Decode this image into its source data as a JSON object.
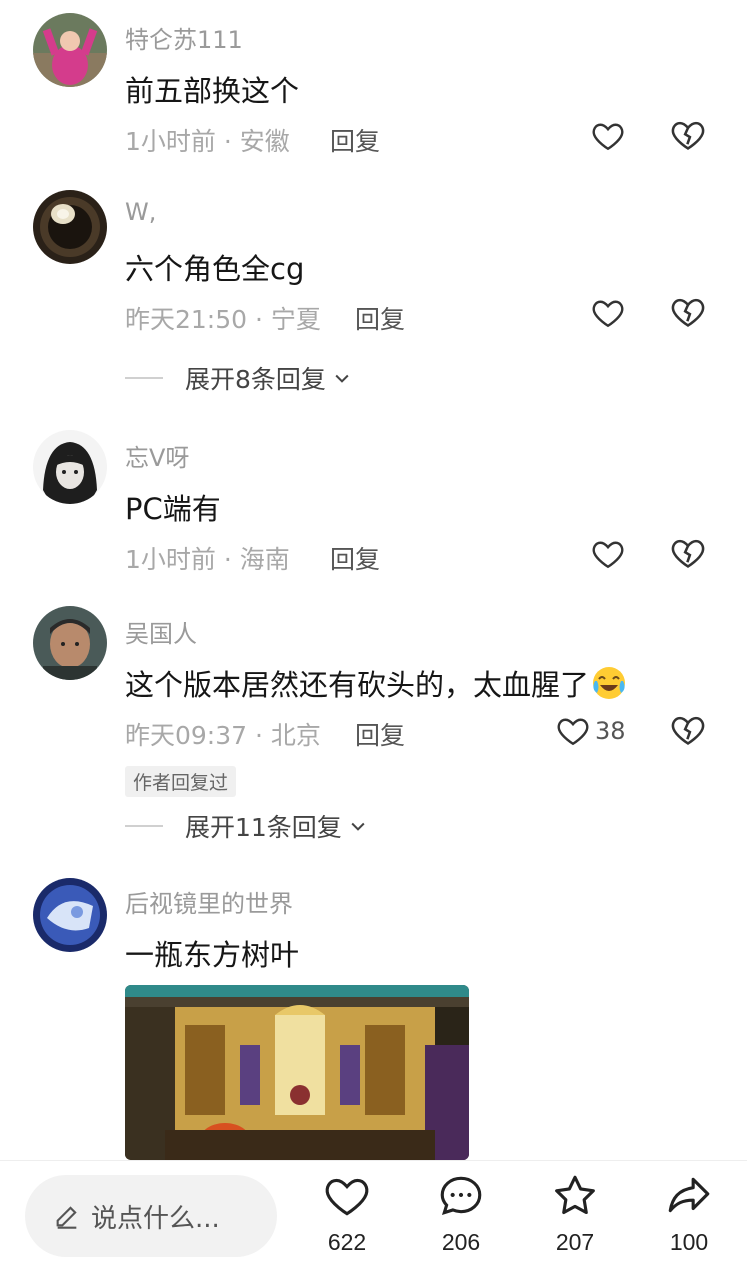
{
  "comments": [
    {
      "username": "特仑苏111",
      "content": "前五部换这个",
      "meta": "1小时前 · 安徽",
      "reply_label": "回复",
      "like_count": ""
    },
    {
      "username": "W,",
      "content": "六个角色全cg",
      "meta": "昨天21:50 · 宁夏",
      "reply_label": "回复",
      "like_count": "",
      "expand_label": "展开8条回复"
    },
    {
      "username": "忘V呀",
      "content": "PC端有",
      "meta": "1小时前 · 海南",
      "reply_label": "回复",
      "like_count": ""
    },
    {
      "username": "吴国人",
      "content": "这个版本居然还有砍头的，太血腥了",
      "meta": "昨天09:37 · 北京",
      "reply_label": "回复",
      "like_count": "38",
      "author_badge": "作者回复过",
      "expand_label": "展开11条回复"
    },
    {
      "username": "后视镜里的世界",
      "content": "一瓶东方树叶",
      "image_icon": "game-screenshot-image"
    }
  ],
  "bottom_bar": {
    "input_placeholder": "说点什么...",
    "like_count": "622",
    "comment_count": "206",
    "favorite_count": "207",
    "share_count": "100"
  },
  "icons": {
    "like": "heart-outline-icon",
    "dislike": "broken-heart-icon",
    "expand": "chevron-down-icon",
    "edit": "pencil-icon",
    "comment": "chat-bubble-icon",
    "favorite": "star-icon",
    "share": "share-arrow-icon",
    "emoji": "crying-laughing-emoji"
  },
  "colors": {
    "text_primary": "#161616",
    "text_secondary": "#9a9a9a",
    "divider": "#eeeeee",
    "pill_bg": "#f2f2f2"
  }
}
